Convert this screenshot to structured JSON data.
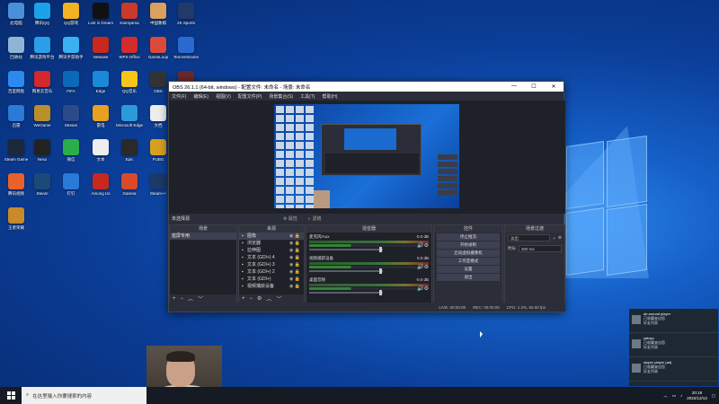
{
  "desktop": {
    "icons": [
      {
        "label": "此电脑",
        "color": "#4a90d9"
      },
      {
        "label": "腾讯QQ",
        "color": "#1aa3e8"
      },
      {
        "label": "QQ游戏",
        "color": "#f2b322"
      },
      {
        "label": "Lost in Dream",
        "color": "#111111"
      },
      {
        "label": "Kamiyama",
        "color": "#c83a2a"
      },
      {
        "label": "中国象棋",
        "color": "#d9a060"
      },
      {
        "label": "2K Sports",
        "color": "#223a6a"
      },
      {
        "label": "回收站",
        "color": "#8fb4d8"
      },
      {
        "label": "腾讯游戏平台",
        "color": "#2a9ee8"
      },
      {
        "label": "腾讯手游助手",
        "color": "#3ab0f0"
      },
      {
        "label": "Netease",
        "color": "#c8281e"
      },
      {
        "label": "WPS Office",
        "color": "#d22c2c"
      },
      {
        "label": "GameLoop",
        "color": "#d94a3a"
      },
      {
        "label": "TencentGame",
        "color": "#2a6ad0"
      },
      {
        "label": "百度网盘",
        "color": "#2a8af0"
      },
      {
        "label": "网易云音乐",
        "color": "#d3282d"
      },
      {
        "label": "FIFA",
        "color": "#0a6ab8"
      },
      {
        "label": "Edge",
        "color": "#1a8ad8"
      },
      {
        "label": "QQ音乐",
        "color": "#f5c518"
      },
      {
        "label": "OBS",
        "color": "#333333"
      },
      {
        "label": "Aida",
        "color": "#6a2a2a"
      },
      {
        "label": "迅雷",
        "color": "#2a7ad8"
      },
      {
        "label": "WeGame",
        "color": "#b8902a"
      },
      {
        "label": "Stream",
        "color": "#2a4a8a"
      },
      {
        "label": "雷电",
        "color": "#e8a020"
      },
      {
        "label": "Microsoft Edge",
        "color": "#2a9ad8"
      },
      {
        "label": "文档",
        "color": "#eeeeee"
      },
      {
        "label": "WeChat",
        "color": "#3ab54a"
      },
      {
        "label": "Steam Game",
        "color": "#1b2838"
      },
      {
        "label": "Nexx",
        "color": "#222222"
      },
      {
        "label": "微信",
        "color": "#2aae4a"
      },
      {
        "label": "文本",
        "color": "#eeeeee"
      },
      {
        "label": "Epic",
        "color": "#2a2a2a"
      },
      {
        "label": "PUBG",
        "color": "#d8a020"
      },
      {
        "label": "QQ",
        "color": "#1a9ae8"
      },
      {
        "label": "腾讯视频",
        "color": "#e8622a"
      },
      {
        "label": "Steam",
        "color": "#1b4a78"
      },
      {
        "label": "钉钉",
        "color": "#2a7ad8"
      },
      {
        "label": "Among Us",
        "color": "#c8281e"
      },
      {
        "label": "Garena",
        "color": "#d84a2a"
      },
      {
        "label": "Steam++",
        "color": "#1b3a68"
      },
      {
        "label": "游戏助手",
        "color": "#e8a020"
      },
      {
        "label": "王者荣耀",
        "color": "#c88a2a"
      }
    ]
  },
  "obs": {
    "title": "OBS 26.1.1 (64-bit, windows) - 配置文件: 未命名 - 场景: 未命名",
    "menu": [
      "文件(F)",
      "编辑(E)",
      "视图(V)",
      "配置文件(P)",
      "场景集合(S)",
      "工具(T)",
      "帮助(H)"
    ],
    "no_source": "未选择源",
    "props_label": "属性",
    "filters_label": "滤镜",
    "docks": {
      "scenes": {
        "title": "场景",
        "items": [
          "蓝屏专用"
        ]
      },
      "sources": {
        "title": "来源",
        "items": [
          {
            "name": "图像",
            "sel": true
          },
          {
            "name": "浏览器",
            "sel": false
          },
          {
            "name": "拉伸图",
            "sel": false
          },
          {
            "name": "文本 (GDI+) 4",
            "sel": false
          },
          {
            "name": "文本 (GDI+) 3",
            "sel": false
          },
          {
            "name": "文本 (GDI+) 2",
            "sel": false
          },
          {
            "name": "文本 (GDI+)",
            "sel": false
          },
          {
            "name": "视频捕获设备",
            "sel": false
          }
        ]
      },
      "mixer": {
        "title": "混音器",
        "channels": [
          {
            "name": "麦克风/Aux",
            "db": "-0.0 dB"
          },
          {
            "name": "视频捕获设备",
            "db": "0.0 dB"
          },
          {
            "name": "桌面音频",
            "db": "-0.0 dB"
          }
        ]
      },
      "controls": {
        "title": "控件",
        "buttons": [
          "停止推流",
          "开始录制",
          "启动虚拟摄像机",
          "工作室模式",
          "设置",
          "退出"
        ]
      },
      "transitions": {
        "title": "场景过渡",
        "value": "淡出",
        "duration_label": "时长",
        "duration": "300 ms"
      }
    },
    "status": {
      "live": "LIVE: 00:00:00",
      "rec": "REC: 00:00:00",
      "cpu": "CPU: 1.2%, 60.00 fps"
    }
  },
  "notifications": [
    {
      "name": "ab around player",
      "line1": "已收藏来自您",
      "line2": "好友列表"
    },
    {
      "name": "yatoyo",
      "line1": "已收藏来自您",
      "line2": "好友列表"
    },
    {
      "name": "stoper player (ad)",
      "line1": "已收藏来自您",
      "line2": "好友列表"
    }
  ],
  "taskbar": {
    "search_placeholder": "在这里输入你要搜索的内容",
    "time": "20:18",
    "date": "2022/12/13"
  }
}
